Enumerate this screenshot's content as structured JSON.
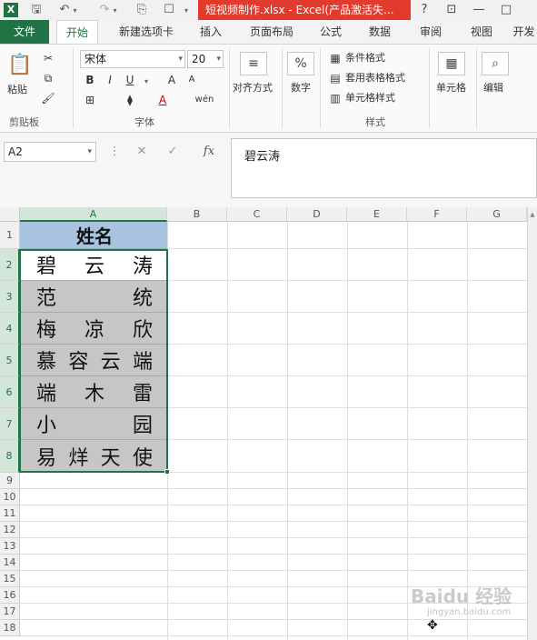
{
  "title_bar": {
    "doc_title": "短视频制作.xlsx -  Excel(产品激活失...",
    "help": "?",
    "ribbon_display": "⊡",
    "minimize": "—",
    "restore": "□"
  },
  "tabs": [
    "文件",
    "开始",
    "新建选项卡",
    "插入",
    "页面布局",
    "公式",
    "数据",
    "审阅",
    "视图",
    "开发"
  ],
  "active_tab": "开始",
  "ribbon": {
    "clipboard": {
      "paste": "粘贴",
      "group": "剪贴板"
    },
    "font": {
      "name": "宋体",
      "size": "20",
      "bold": "B",
      "italic": "I",
      "underline": "U",
      "grow": "A",
      "shrink": "A",
      "font_color": "A",
      "phonetic": "wén",
      "group": "字体"
    },
    "alignment": {
      "label": "对齐方式"
    },
    "number": {
      "label": "数字",
      "symbol": "%"
    },
    "styles": {
      "conditional": "条件格式",
      "table": "套用表格格式",
      "cell_styles": "单元格样式",
      "group": "样式"
    },
    "cells": {
      "label": "单元格"
    },
    "editing": {
      "label": "编辑"
    }
  },
  "formula_bar": {
    "name_box": "A2",
    "cancel": "✕",
    "enter": "✓",
    "fx": "fx",
    "content": "碧云涛"
  },
  "sheet": {
    "columns": [
      "A",
      "B",
      "C",
      "D",
      "E",
      "F",
      "G"
    ],
    "rows": [
      "1",
      "2",
      "3",
      "4",
      "5",
      "6",
      "7",
      "8",
      "9",
      "10",
      "11",
      "12",
      "13",
      "14",
      "15",
      "16",
      "17",
      "18"
    ],
    "header": "姓名",
    "names": [
      [
        "碧",
        "云",
        "涛"
      ],
      [
        "范",
        "统"
      ],
      [
        "梅",
        "凉",
        "欣"
      ],
      [
        "慕",
        "容",
        "云",
        "端"
      ],
      [
        "端",
        "木",
        "雷"
      ],
      [
        "小",
        "园"
      ],
      [
        "易",
        "烊",
        "天",
        "使"
      ]
    ]
  },
  "watermark": {
    "brand": "Baidu 经验",
    "url": "jingyan.baidu.com"
  }
}
